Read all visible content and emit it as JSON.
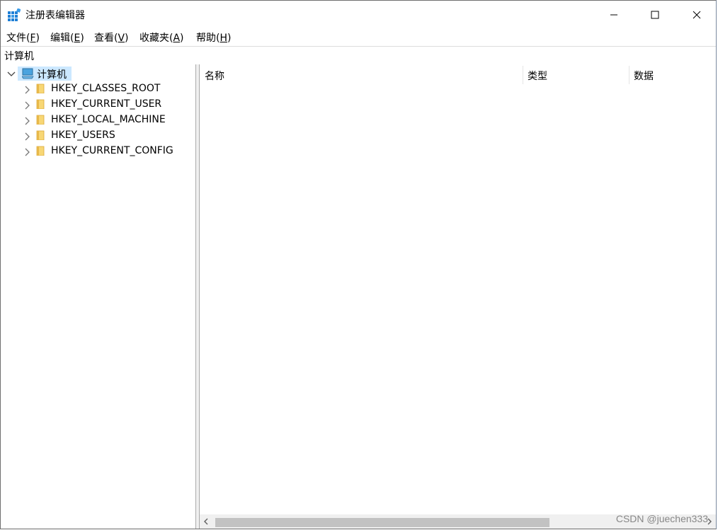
{
  "window": {
    "title": "注册表编辑器",
    "controls": {
      "minimize": "minimize",
      "maximize": "maximize",
      "close": "close"
    }
  },
  "menu": [
    {
      "label": "文件(",
      "key": "F",
      "end": ")"
    },
    {
      "label": "编辑(",
      "key": "E",
      "end": ")"
    },
    {
      "label": "查看(",
      "key": "V",
      "end": ")"
    },
    {
      "label": "收藏夹(",
      "key": "A",
      "end": ")"
    },
    {
      "label": "帮助(",
      "key": "H",
      "end": ")"
    }
  ],
  "address": {
    "value": "计算机"
  },
  "tree": {
    "root": {
      "label": "计算机",
      "expanded": true,
      "icon": "computer-icon"
    },
    "keys": [
      {
        "label": "HKEY_CLASSES_ROOT"
      },
      {
        "label": "HKEY_CURRENT_USER"
      },
      {
        "label": "HKEY_LOCAL_MACHINE"
      },
      {
        "label": "HKEY_USERS"
      },
      {
        "label": "HKEY_CURRENT_CONFIG"
      }
    ]
  },
  "list": {
    "columns": [
      "名称",
      "类型",
      "数据"
    ],
    "rows": []
  },
  "watermark": "CSDN @juechen333",
  "colors": {
    "selection": "#cce8ff",
    "folder": "#f8d775",
    "accent": "#0078d7"
  }
}
